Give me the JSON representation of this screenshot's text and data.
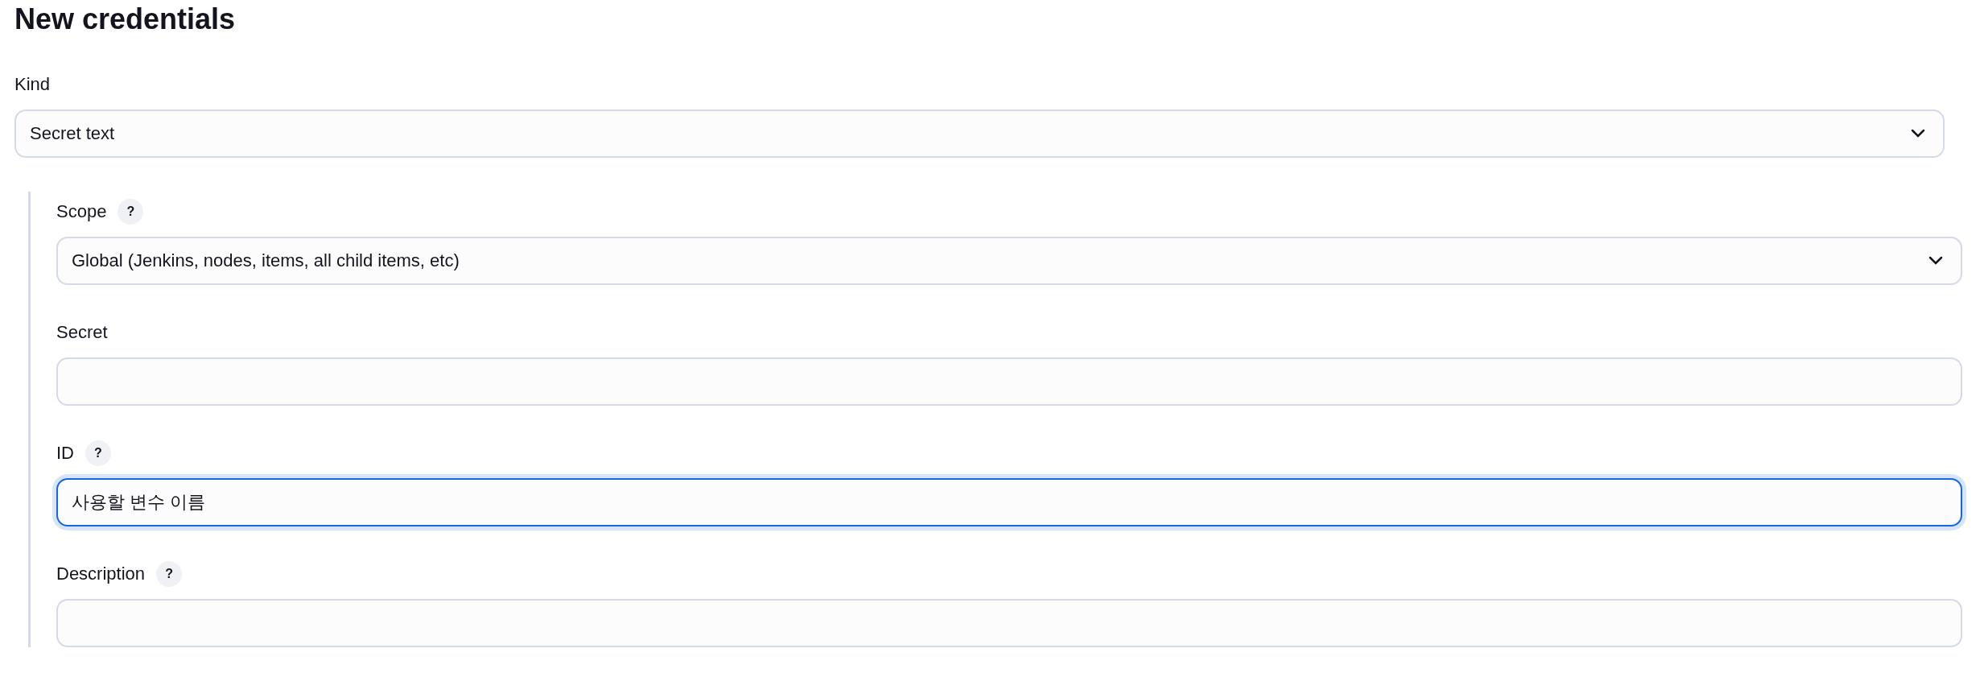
{
  "title": "New credentials",
  "kind": {
    "label": "Kind",
    "kind": "select",
    "value": "Secret text",
    "focused": false
  },
  "fields": [
    {
      "label": "Scope",
      "help": "?",
      "kind": "select",
      "value": "Global (Jenkins, nodes, items, all child items, etc)",
      "focused": false
    },
    {
      "label": "Secret",
      "kind": "text",
      "focused": false
    },
    {
      "label": "ID",
      "help": "?",
      "kind": "text",
      "value": "사용할 변수 이름",
      "focused": true
    },
    {
      "label": "Description",
      "help": "?",
      "kind": "text",
      "focused": false
    }
  ]
}
